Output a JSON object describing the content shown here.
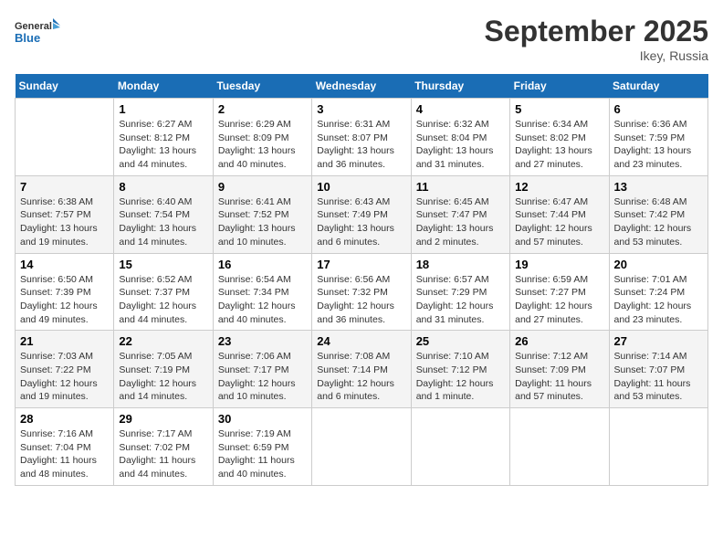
{
  "logo": {
    "text_general": "General",
    "text_blue": "Blue"
  },
  "title": "September 2025",
  "location": "Ikey, Russia",
  "days_of_week": [
    "Sunday",
    "Monday",
    "Tuesday",
    "Wednesday",
    "Thursday",
    "Friday",
    "Saturday"
  ],
  "weeks": [
    [
      {
        "day": "",
        "info": ""
      },
      {
        "day": "1",
        "info": "Sunrise: 6:27 AM\nSunset: 8:12 PM\nDaylight: 13 hours\nand 44 minutes."
      },
      {
        "day": "2",
        "info": "Sunrise: 6:29 AM\nSunset: 8:09 PM\nDaylight: 13 hours\nand 40 minutes."
      },
      {
        "day": "3",
        "info": "Sunrise: 6:31 AM\nSunset: 8:07 PM\nDaylight: 13 hours\nand 36 minutes."
      },
      {
        "day": "4",
        "info": "Sunrise: 6:32 AM\nSunset: 8:04 PM\nDaylight: 13 hours\nand 31 minutes."
      },
      {
        "day": "5",
        "info": "Sunrise: 6:34 AM\nSunset: 8:02 PM\nDaylight: 13 hours\nand 27 minutes."
      },
      {
        "day": "6",
        "info": "Sunrise: 6:36 AM\nSunset: 7:59 PM\nDaylight: 13 hours\nand 23 minutes."
      }
    ],
    [
      {
        "day": "7",
        "info": "Sunrise: 6:38 AM\nSunset: 7:57 PM\nDaylight: 13 hours\nand 19 minutes."
      },
      {
        "day": "8",
        "info": "Sunrise: 6:40 AM\nSunset: 7:54 PM\nDaylight: 13 hours\nand 14 minutes."
      },
      {
        "day": "9",
        "info": "Sunrise: 6:41 AM\nSunset: 7:52 PM\nDaylight: 13 hours\nand 10 minutes."
      },
      {
        "day": "10",
        "info": "Sunrise: 6:43 AM\nSunset: 7:49 PM\nDaylight: 13 hours\nand 6 minutes."
      },
      {
        "day": "11",
        "info": "Sunrise: 6:45 AM\nSunset: 7:47 PM\nDaylight: 13 hours\nand 2 minutes."
      },
      {
        "day": "12",
        "info": "Sunrise: 6:47 AM\nSunset: 7:44 PM\nDaylight: 12 hours\nand 57 minutes."
      },
      {
        "day": "13",
        "info": "Sunrise: 6:48 AM\nSunset: 7:42 PM\nDaylight: 12 hours\nand 53 minutes."
      }
    ],
    [
      {
        "day": "14",
        "info": "Sunrise: 6:50 AM\nSunset: 7:39 PM\nDaylight: 12 hours\nand 49 minutes."
      },
      {
        "day": "15",
        "info": "Sunrise: 6:52 AM\nSunset: 7:37 PM\nDaylight: 12 hours\nand 44 minutes."
      },
      {
        "day": "16",
        "info": "Sunrise: 6:54 AM\nSunset: 7:34 PM\nDaylight: 12 hours\nand 40 minutes."
      },
      {
        "day": "17",
        "info": "Sunrise: 6:56 AM\nSunset: 7:32 PM\nDaylight: 12 hours\nand 36 minutes."
      },
      {
        "day": "18",
        "info": "Sunrise: 6:57 AM\nSunset: 7:29 PM\nDaylight: 12 hours\nand 31 minutes."
      },
      {
        "day": "19",
        "info": "Sunrise: 6:59 AM\nSunset: 7:27 PM\nDaylight: 12 hours\nand 27 minutes."
      },
      {
        "day": "20",
        "info": "Sunrise: 7:01 AM\nSunset: 7:24 PM\nDaylight: 12 hours\nand 23 minutes."
      }
    ],
    [
      {
        "day": "21",
        "info": "Sunrise: 7:03 AM\nSunset: 7:22 PM\nDaylight: 12 hours\nand 19 minutes."
      },
      {
        "day": "22",
        "info": "Sunrise: 7:05 AM\nSunset: 7:19 PM\nDaylight: 12 hours\nand 14 minutes."
      },
      {
        "day": "23",
        "info": "Sunrise: 7:06 AM\nSunset: 7:17 PM\nDaylight: 12 hours\nand 10 minutes."
      },
      {
        "day": "24",
        "info": "Sunrise: 7:08 AM\nSunset: 7:14 PM\nDaylight: 12 hours\nand 6 minutes."
      },
      {
        "day": "25",
        "info": "Sunrise: 7:10 AM\nSunset: 7:12 PM\nDaylight: 12 hours\nand 1 minute."
      },
      {
        "day": "26",
        "info": "Sunrise: 7:12 AM\nSunset: 7:09 PM\nDaylight: 11 hours\nand 57 minutes."
      },
      {
        "day": "27",
        "info": "Sunrise: 7:14 AM\nSunset: 7:07 PM\nDaylight: 11 hours\nand 53 minutes."
      }
    ],
    [
      {
        "day": "28",
        "info": "Sunrise: 7:16 AM\nSunset: 7:04 PM\nDaylight: 11 hours\nand 48 minutes."
      },
      {
        "day": "29",
        "info": "Sunrise: 7:17 AM\nSunset: 7:02 PM\nDaylight: 11 hours\nand 44 minutes."
      },
      {
        "day": "30",
        "info": "Sunrise: 7:19 AM\nSunset: 6:59 PM\nDaylight: 11 hours\nand 40 minutes."
      },
      {
        "day": "",
        "info": ""
      },
      {
        "day": "",
        "info": ""
      },
      {
        "day": "",
        "info": ""
      },
      {
        "day": "",
        "info": ""
      }
    ]
  ]
}
